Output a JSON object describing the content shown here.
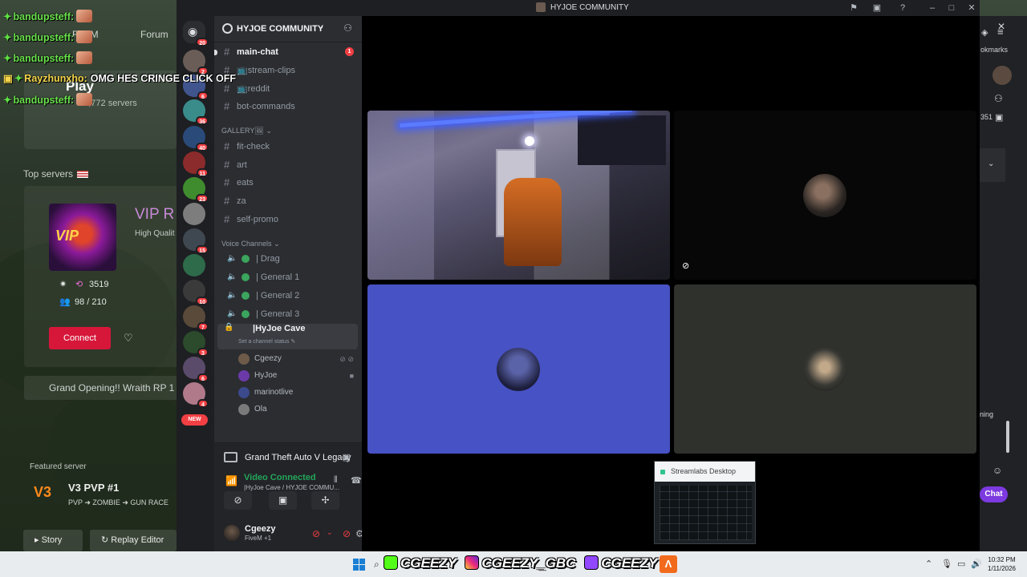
{
  "fivem": {
    "nav": [
      "FiveM",
      "Forum"
    ],
    "play_label": "Play",
    "servers_count": "81,772 servers",
    "top_servers_label": "Top servers",
    "vip": {
      "title": "VIP R",
      "subtitle": "High Qualit",
      "boosts": "3519",
      "players": "98 / 210",
      "connect_label": "Connect"
    },
    "banner": "Grand Opening!! Wraith RP 1",
    "featured_label": "Featured server",
    "featured": {
      "logo": "V3",
      "title": "V3 PVP #1",
      "subtitle": "PVP ➜ ZOMBIE ➜ GUN RACE"
    },
    "buttons": {
      "story": "Story",
      "replay": "Replay Editor"
    }
  },
  "browser": {
    "bookmarks": "okmarks",
    "number": "351",
    "text1": "ning",
    "chat": "Chat"
  },
  "stream_chat": [
    {
      "user": "bandupsteff:",
      "msg": "",
      "color": "#69e04c"
    },
    {
      "user": "bandupsteff:",
      "msg": "",
      "color": "#69e04c"
    },
    {
      "user": "bandupsteff:",
      "msg": "",
      "color": "#69e04c"
    },
    {
      "user": "Rayzhunxho:",
      "msg": "OMG HES CRINGE CLICK OFF",
      "color": "#f4d44a"
    },
    {
      "user": "bandupsteff:",
      "msg": "",
      "color": "#69e04c"
    }
  ],
  "discord": {
    "window_title": "HYJOE COMMUNITY",
    "server_name": "HYJOE COMMUNITY",
    "rail_badges": [
      "20",
      "2",
      "",
      "6",
      "36",
      "40",
      "11",
      "23",
      "",
      "15",
      "",
      "10",
      "7",
      "3",
      "6",
      "4"
    ],
    "rail_new": "NEW",
    "channels_top": [
      {
        "label": "main-chat",
        "unread": true,
        "mention": "1"
      },
      {
        "label": "📺stream-clips",
        "unread": false
      },
      {
        "label": "📺reddit",
        "unread": false
      },
      {
        "label": "bot-commands",
        "unread": false
      }
    ],
    "gallery_category": "GALLERY🖼",
    "gallery_channels": [
      "fit-check",
      "art",
      "eats",
      "za",
      "self-promo"
    ],
    "voice_category": "Voice Channels",
    "voice_channels": [
      "| Drag",
      "| General 1",
      "| General 2",
      "| General 3"
    ],
    "active_channel": {
      "label": "|HyJoe Cave",
      "status": "Set a channel status"
    },
    "members": [
      {
        "name": "Cgeezy",
        "color": "#6e5a48"
      },
      {
        "name": "HyJoe",
        "color": "#6b3aa8"
      },
      {
        "name": "marinotlive",
        "color": "#3b4a8c"
      },
      {
        "name": "Ola",
        "color": "#7a7a7a"
      }
    ],
    "game_activity": "Grand Theft Auto V Legacy",
    "voice_status": "Video Connected",
    "voice_location": "|HyJoe Cave / HYJOE COMMU...",
    "user": {
      "name": "Cgeezy",
      "status": "FiveM +1"
    },
    "screen_share_title": "Streamlabs Desktop",
    "colors": {
      "tile_blue": "#4752c4",
      "tile_gray": "#2f312d",
      "accent_green": "#23a55a",
      "danger": "#f23f43"
    }
  },
  "taskbar": {
    "social_handles": [
      "CGEEZY",
      "CGEEZY_GBC",
      "CGEEZY"
    ],
    "time": "10:32 PM",
    "date": "1/11/2026"
  }
}
